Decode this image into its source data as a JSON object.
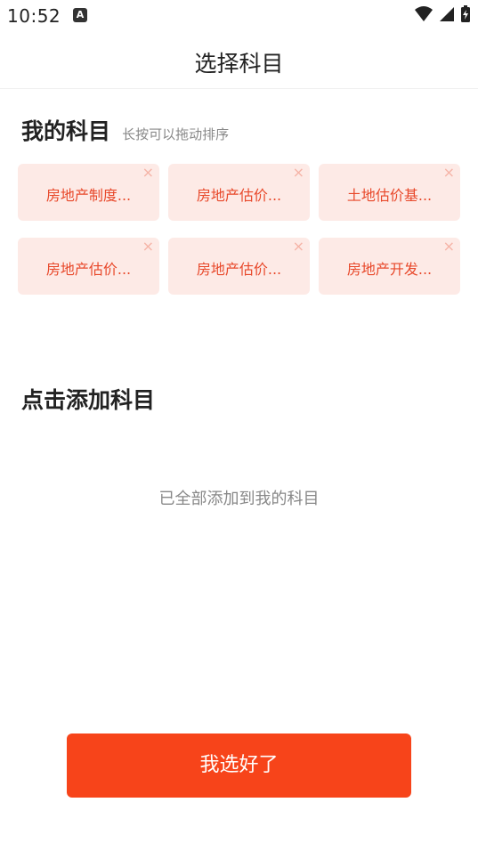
{
  "status_bar": {
    "time": "10:52",
    "badge": "A",
    "icons": [
      "wifi-icon",
      "signal-icon",
      "battery-charging-icon"
    ]
  },
  "header": {
    "title": "选择科目"
  },
  "my_subjects": {
    "title": "我的科目",
    "hint": "长按可以拖动排序",
    "items": [
      {
        "label": "房地产制度...",
        "close": "×"
      },
      {
        "label": "房地产估价...",
        "close": "×"
      },
      {
        "label": "土地估价基...",
        "close": "×"
      },
      {
        "label": "房地产估价...",
        "close": "×"
      },
      {
        "label": "房地产估价...",
        "close": "×"
      },
      {
        "label": "房地产开发...",
        "close": "×"
      }
    ]
  },
  "add_subjects": {
    "title": "点击添加科目",
    "empty_text": "已全部添加到我的科目"
  },
  "footer": {
    "confirm_label": "我选好了"
  },
  "colors": {
    "accent": "#f7441a",
    "chip_bg": "#fdeae6",
    "chip_text": "#e8482a"
  }
}
